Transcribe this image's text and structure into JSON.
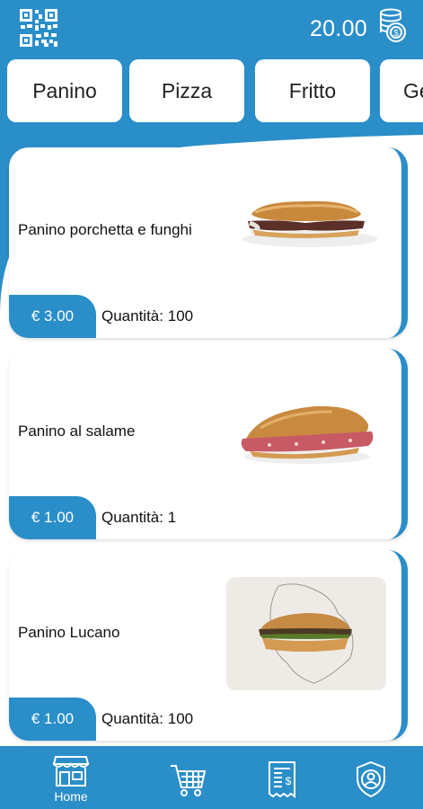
{
  "header": {
    "qr_icon": "qr-code-icon",
    "balance": "20.00",
    "coins_icon": "coins-icon"
  },
  "tabs": [
    {
      "label": "Panino"
    },
    {
      "label": "Pizza"
    },
    {
      "label": "Fritto"
    },
    {
      "label": "Ge"
    }
  ],
  "products": [
    {
      "name": "Panino porchetta e funghi",
      "price": "€ 3.00",
      "qty_label": "Quantità:",
      "qty": "100",
      "image": "porchetta-sandwich"
    },
    {
      "name": "Panino al salame",
      "price": "€ 1.00",
      "qty_label": "Quantità:",
      "qty": "1",
      "image": "salame-sandwich"
    },
    {
      "name": "Panino Lucano",
      "price": "€ 1.00",
      "qty_label": "Quantità:",
      "qty": "100",
      "image": "lucano-sandwich"
    }
  ],
  "bottom_nav": [
    {
      "label": "Home",
      "icon": "shop-icon"
    },
    {
      "label": "",
      "icon": "cart-icon"
    },
    {
      "label": "",
      "icon": "receipt-icon"
    },
    {
      "label": "",
      "icon": "user-shield-icon"
    }
  ],
  "colors": {
    "primary": "#2a8ec9",
    "card": "#ffffff",
    "text": "#111111"
  }
}
